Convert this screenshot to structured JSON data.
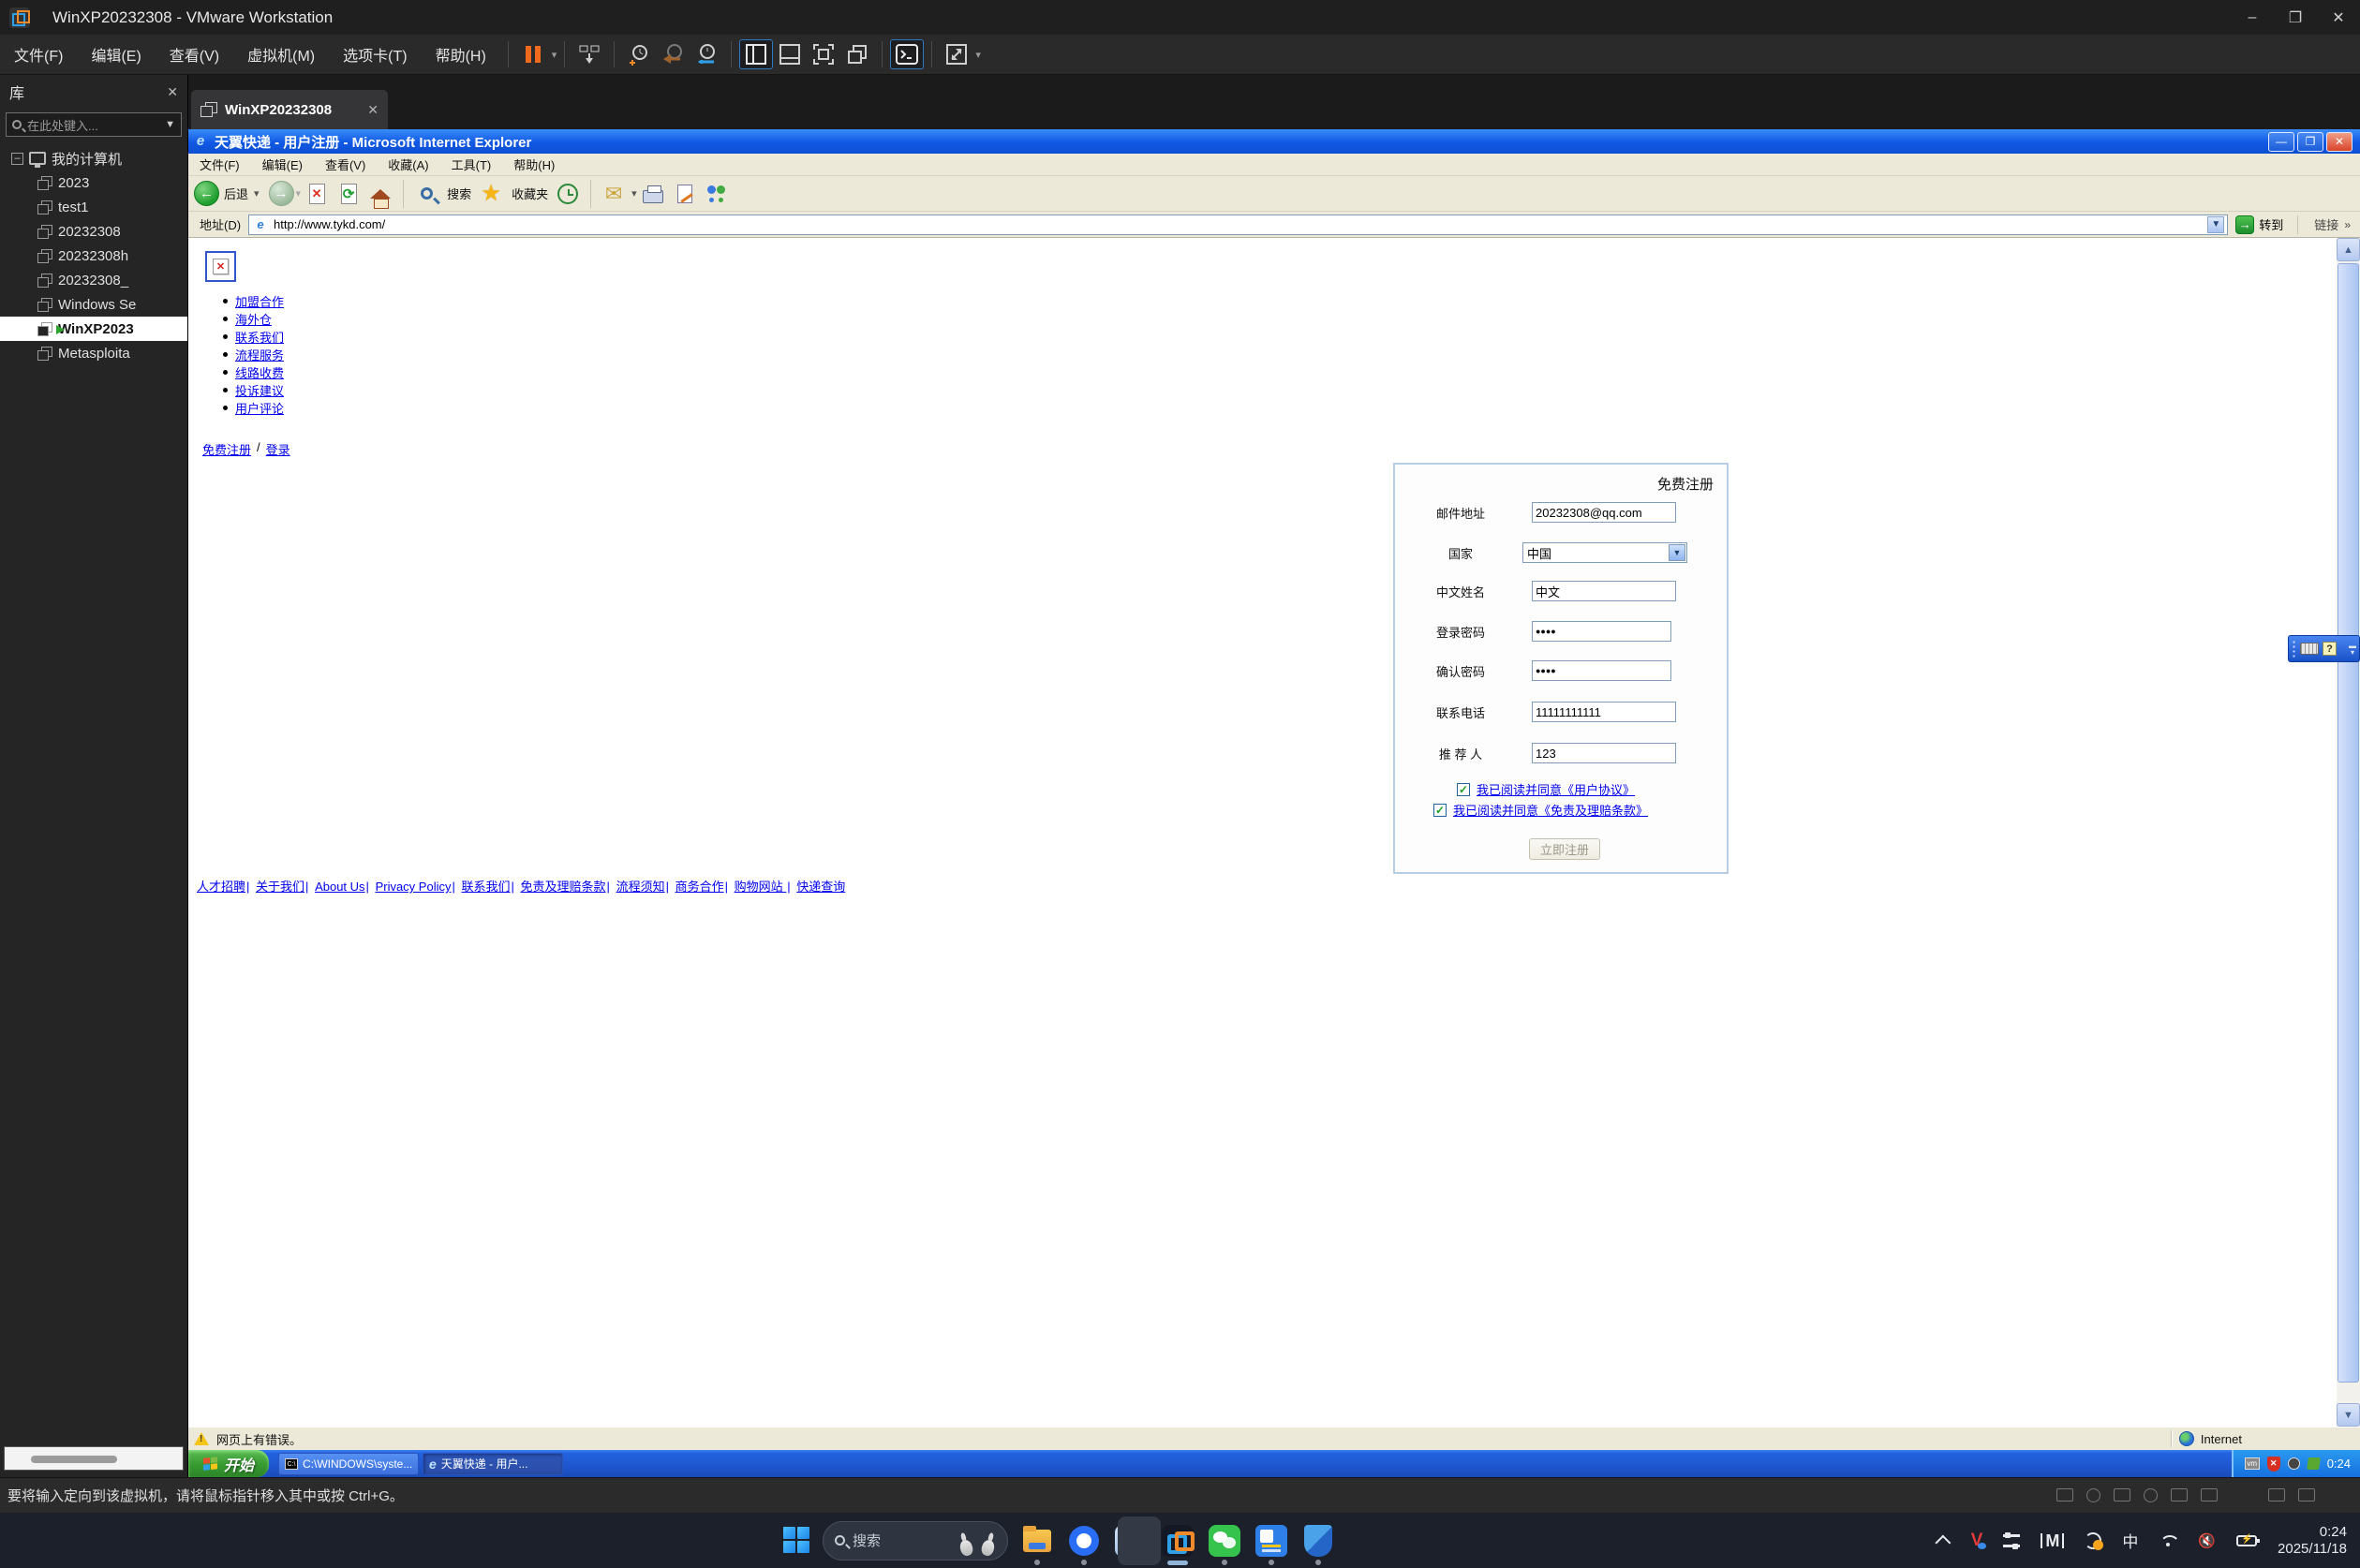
{
  "vmware": {
    "title": "WinXP20232308 - VMware Workstation",
    "menu": [
      "文件(F)",
      "编辑(E)",
      "查看(V)",
      "虚拟机(M)",
      "选项卡(T)",
      "帮助(H)"
    ],
    "sidebar": {
      "header": "库",
      "search_placeholder": "在此处键入...",
      "tree_root": "我的计算机",
      "items": [
        "2023",
        "test1",
        "20232308",
        "20232308h",
        "20232308_",
        "Windows Se",
        "WinXP2023",
        "Metasploita"
      ]
    },
    "tab_label": "WinXP20232308",
    "status_text": "要将输入定向到该虚拟机，请将鼠标指针移入其中或按 Ctrl+G。"
  },
  "ie": {
    "title": "天翼快递 - 用户注册 - Microsoft Internet Explorer",
    "menu": [
      "文件(F)",
      "编辑(E)",
      "查看(V)",
      "收藏(A)",
      "工具(T)",
      "帮助(H)"
    ],
    "toolbar": {
      "back": "后退",
      "search": "搜索",
      "favorites": "收藏夹"
    },
    "address_label": "地址(D)",
    "address_value": "http://www.tykd.com/",
    "go_label": "转到",
    "links_label": "链接",
    "status_left": "网页上有错误。",
    "status_right": "Internet"
  },
  "page": {
    "nav_links": [
      "加盟合作",
      "海外仓",
      "联系我们",
      "流程服务",
      "线路收费",
      "投诉建议",
      "用户评论"
    ],
    "register_link": "免费注册",
    "sep": "/",
    "login_link": "登录",
    "form": {
      "title": "免费注册",
      "fields": [
        {
          "label": "邮件地址",
          "value": "20232308@qq.com"
        },
        {
          "label": "国家",
          "value": "中国"
        },
        {
          "label": "中文姓名",
          "value": "中文"
        },
        {
          "label": "登录密码",
          "value": "●●●●"
        },
        {
          "label": "确认密码",
          "value": "●●●●"
        },
        {
          "label": "联系电话",
          "value": "11111111111"
        },
        {
          "label": "推 荐 人",
          "value": "123"
        }
      ],
      "agreement1": "我已阅读并同意《用户协议》",
      "agreement2": "我已阅读并同意《免责及理赔条款》",
      "submit_label": "立即注册"
    },
    "footer_sep": "|",
    "footer_links": [
      "人才招聘",
      "关于我们",
      "About Us",
      "Privacy Policy",
      "联系我们",
      "免责及理赔条款",
      "流程须知",
      "商务合作",
      "购物网站 ",
      "快递查询"
    ]
  },
  "xp": {
    "start_label": "开始",
    "task1": "C:\\WINDOWS\\syste...",
    "task2": "天翼快递 - 用户...",
    "tray_time": "0:24",
    "vm_chip": "vm"
  },
  "win11": {
    "search_placeholder": "搜索",
    "ime": "中",
    "time": "0:24",
    "date": "2025/11/18"
  }
}
